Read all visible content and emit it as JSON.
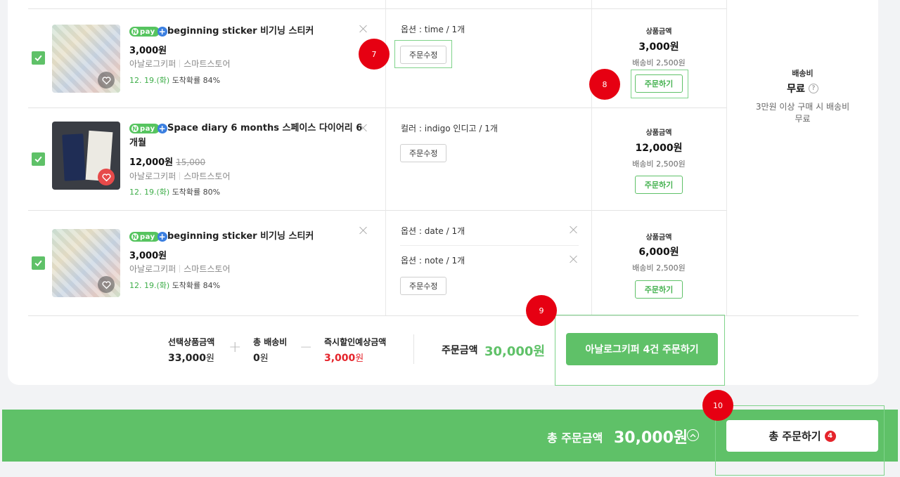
{
  "items": [
    {
      "name": "beginning sticker 비기닝 스티커",
      "price": "3,000원",
      "old_price": "",
      "seller": "아날로그키퍼",
      "store": "스마트스토어",
      "ship_date": "12. 19.(화)",
      "ship_rate": "도착확률 84%",
      "options": [
        "옵션 : time / 1개"
      ],
      "edit_label": "주문수정",
      "amount_label": "상품금액",
      "amount": "3,000원",
      "ship_fee": "배송비 2,500원",
      "order_label": "주문하기",
      "favorited": false
    },
    {
      "name": "Space diary 6 months 스페이스 다이어리 6 개월",
      "name_line1": "Space diary 6 months 스페이스 다이어리 6",
      "name_line2": "개월",
      "price": "12,000원",
      "old_price": "15,000",
      "seller": "아날로그키퍼",
      "store": "스마트스토어",
      "ship_date": "12. 19.(화)",
      "ship_rate": "도착확률 80%",
      "options": [
        "컬러 : indigo 인디고 / 1개"
      ],
      "edit_label": "주문수정",
      "amount_label": "상품금액",
      "amount": "12,000원",
      "ship_fee": "배송비 2,500원",
      "order_label": "주문하기",
      "favorited": true
    },
    {
      "name": "beginning sticker 비기닝 스티커",
      "price": "3,000원",
      "old_price": "",
      "seller": "아날로그키퍼",
      "store": "스마트스토어",
      "ship_date": "12. 19.(화)",
      "ship_rate": "도착확률 84%",
      "options": [
        "옵션 : date / 1개",
        "옵션 : note / 1개"
      ],
      "edit_label": "주문수정",
      "amount_label": "상품금액",
      "amount": "6,000원",
      "ship_fee": "배송비 2,500원",
      "order_label": "주문하기",
      "favorited": false
    }
  ],
  "npay_label": "pay",
  "shipping_panel": {
    "label": "배송비",
    "value": "무료",
    "help": "?",
    "note_line1": "3만원 이상 구매 시 배송비",
    "note_line2": "무료"
  },
  "summary": {
    "selected_label": "선택상품금액",
    "selected_value": "33,000",
    "ship_label": "총 배송비",
    "ship_value": "0",
    "discount_label": "즉시할인예상금액",
    "discount_value": "3,000",
    "won": "원",
    "order_label": "주문금액",
    "order_value": "30,000원",
    "seller_button": "아날로그키퍼  4건 주문하기"
  },
  "footer": {
    "label": "총 주문금액",
    "total": "30,000원",
    "button": "총 주문하기",
    "count": "4"
  },
  "markers": [
    "7",
    "8",
    "9",
    "10"
  ],
  "colors": {
    "accent": "#5fc168",
    "discount": "#e5242b",
    "marker": "#e60012"
  }
}
